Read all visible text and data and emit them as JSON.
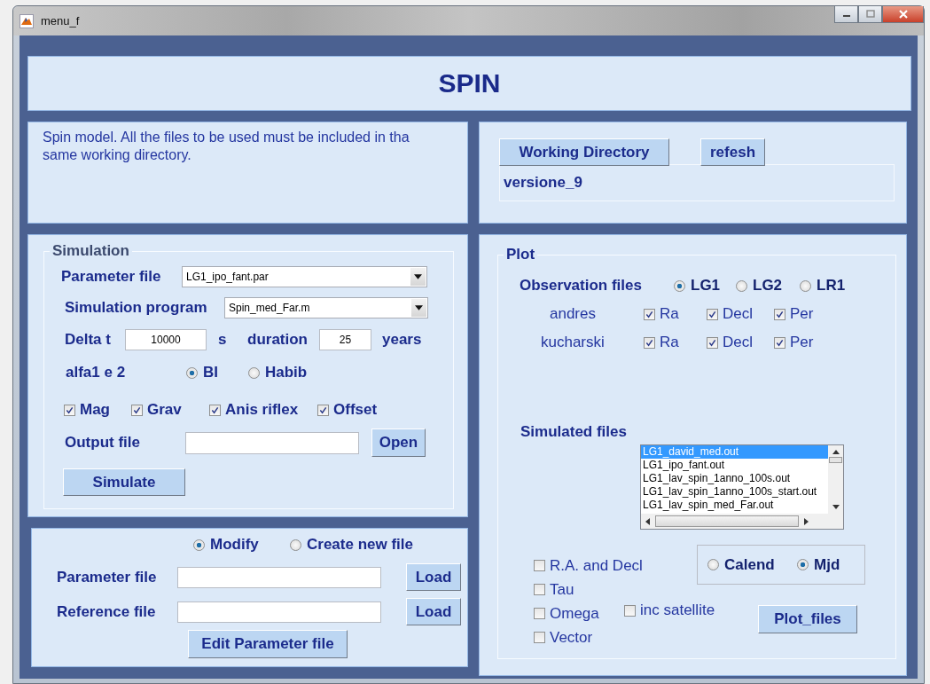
{
  "window": {
    "title": "menu_f"
  },
  "header": {
    "title": "SPIN"
  },
  "description": "Spin model. All the files to be used must be included in tha same working directory.",
  "working_dir": {
    "buttons": [
      "Working Directory",
      "refesh"
    ],
    "path": "versione_9"
  },
  "simulation": {
    "legend": "Simulation",
    "parameter_file": {
      "label": "Parameter file",
      "value": "LG1_ipo_fant.par"
    },
    "program": {
      "label": "Simulation program",
      "value": "Spin_med_Far.m"
    },
    "delta_t": {
      "label": "Delta t",
      "value": "10000",
      "unit": "s"
    },
    "duration": {
      "label": "duration",
      "value": "25",
      "unit": "years"
    },
    "alfa": {
      "label": "alfa1 e 2",
      "options": [
        {
          "label": "BI",
          "selected": true
        },
        {
          "label": "Habib",
          "selected": false
        }
      ]
    },
    "checks": [
      {
        "label": "Mag",
        "checked": true
      },
      {
        "label": "Grav",
        "checked": true
      },
      {
        "label": "Anis riflex",
        "checked": true
      },
      {
        "label": "Offset",
        "checked": true
      }
    ],
    "output": {
      "label": "Output file",
      "button": "Open"
    },
    "simulate_button": "Simulate"
  },
  "edit": {
    "modes": [
      {
        "label": "Modify",
        "selected": true
      },
      {
        "label": "Create new file",
        "selected": false
      }
    ],
    "fields": [
      {
        "label": "Parameter file",
        "button": "Load"
      },
      {
        "label": "Reference file",
        "button": "Load"
      }
    ],
    "edit_button": "Edit Parameter file"
  },
  "plot": {
    "legend": "Plot",
    "observation": {
      "label": "Observation files",
      "options": [
        {
          "label": "LG1",
          "selected": true
        },
        {
          "label": "LG2",
          "selected": false
        },
        {
          "label": "LR1",
          "selected": false
        }
      ]
    },
    "sources": [
      {
        "name": "andres",
        "checks": [
          {
            "label": "Ra",
            "checked": true
          },
          {
            "label": "Decl",
            "checked": true
          },
          {
            "label": "Per",
            "checked": true
          }
        ]
      },
      {
        "name": "kucharski",
        "checks": [
          {
            "label": "Ra",
            "checked": true
          },
          {
            "label": "Decl",
            "checked": true
          },
          {
            "label": "Per",
            "checked": true
          }
        ]
      }
    ],
    "simulated": {
      "label": "Simulated files",
      "files": [
        {
          "name": "LG1_david_med.out",
          "selected": true
        },
        {
          "name": "LG1_ipo_fant.out",
          "selected": false
        },
        {
          "name": "LG1_lav_spin_1anno_100s.out",
          "selected": false
        },
        {
          "name": "LG1_lav_spin_1anno_100s_start.out",
          "selected": false
        },
        {
          "name": "LG1_lav_spin_med_Far.out",
          "selected": false
        }
      ]
    },
    "options": [
      {
        "label": "R.A. and Decl",
        "checked": false
      },
      {
        "label": "Tau",
        "checked": false
      },
      {
        "label": "Omega",
        "checked": false
      },
      {
        "label": "Vector",
        "checked": false
      }
    ],
    "inc_satellite": {
      "label": "inc satellite",
      "checked": false
    },
    "time": [
      {
        "label": "Calend",
        "selected": false
      },
      {
        "label": "Mjd",
        "selected": true
      }
    ],
    "plot_button": "Plot_files"
  }
}
